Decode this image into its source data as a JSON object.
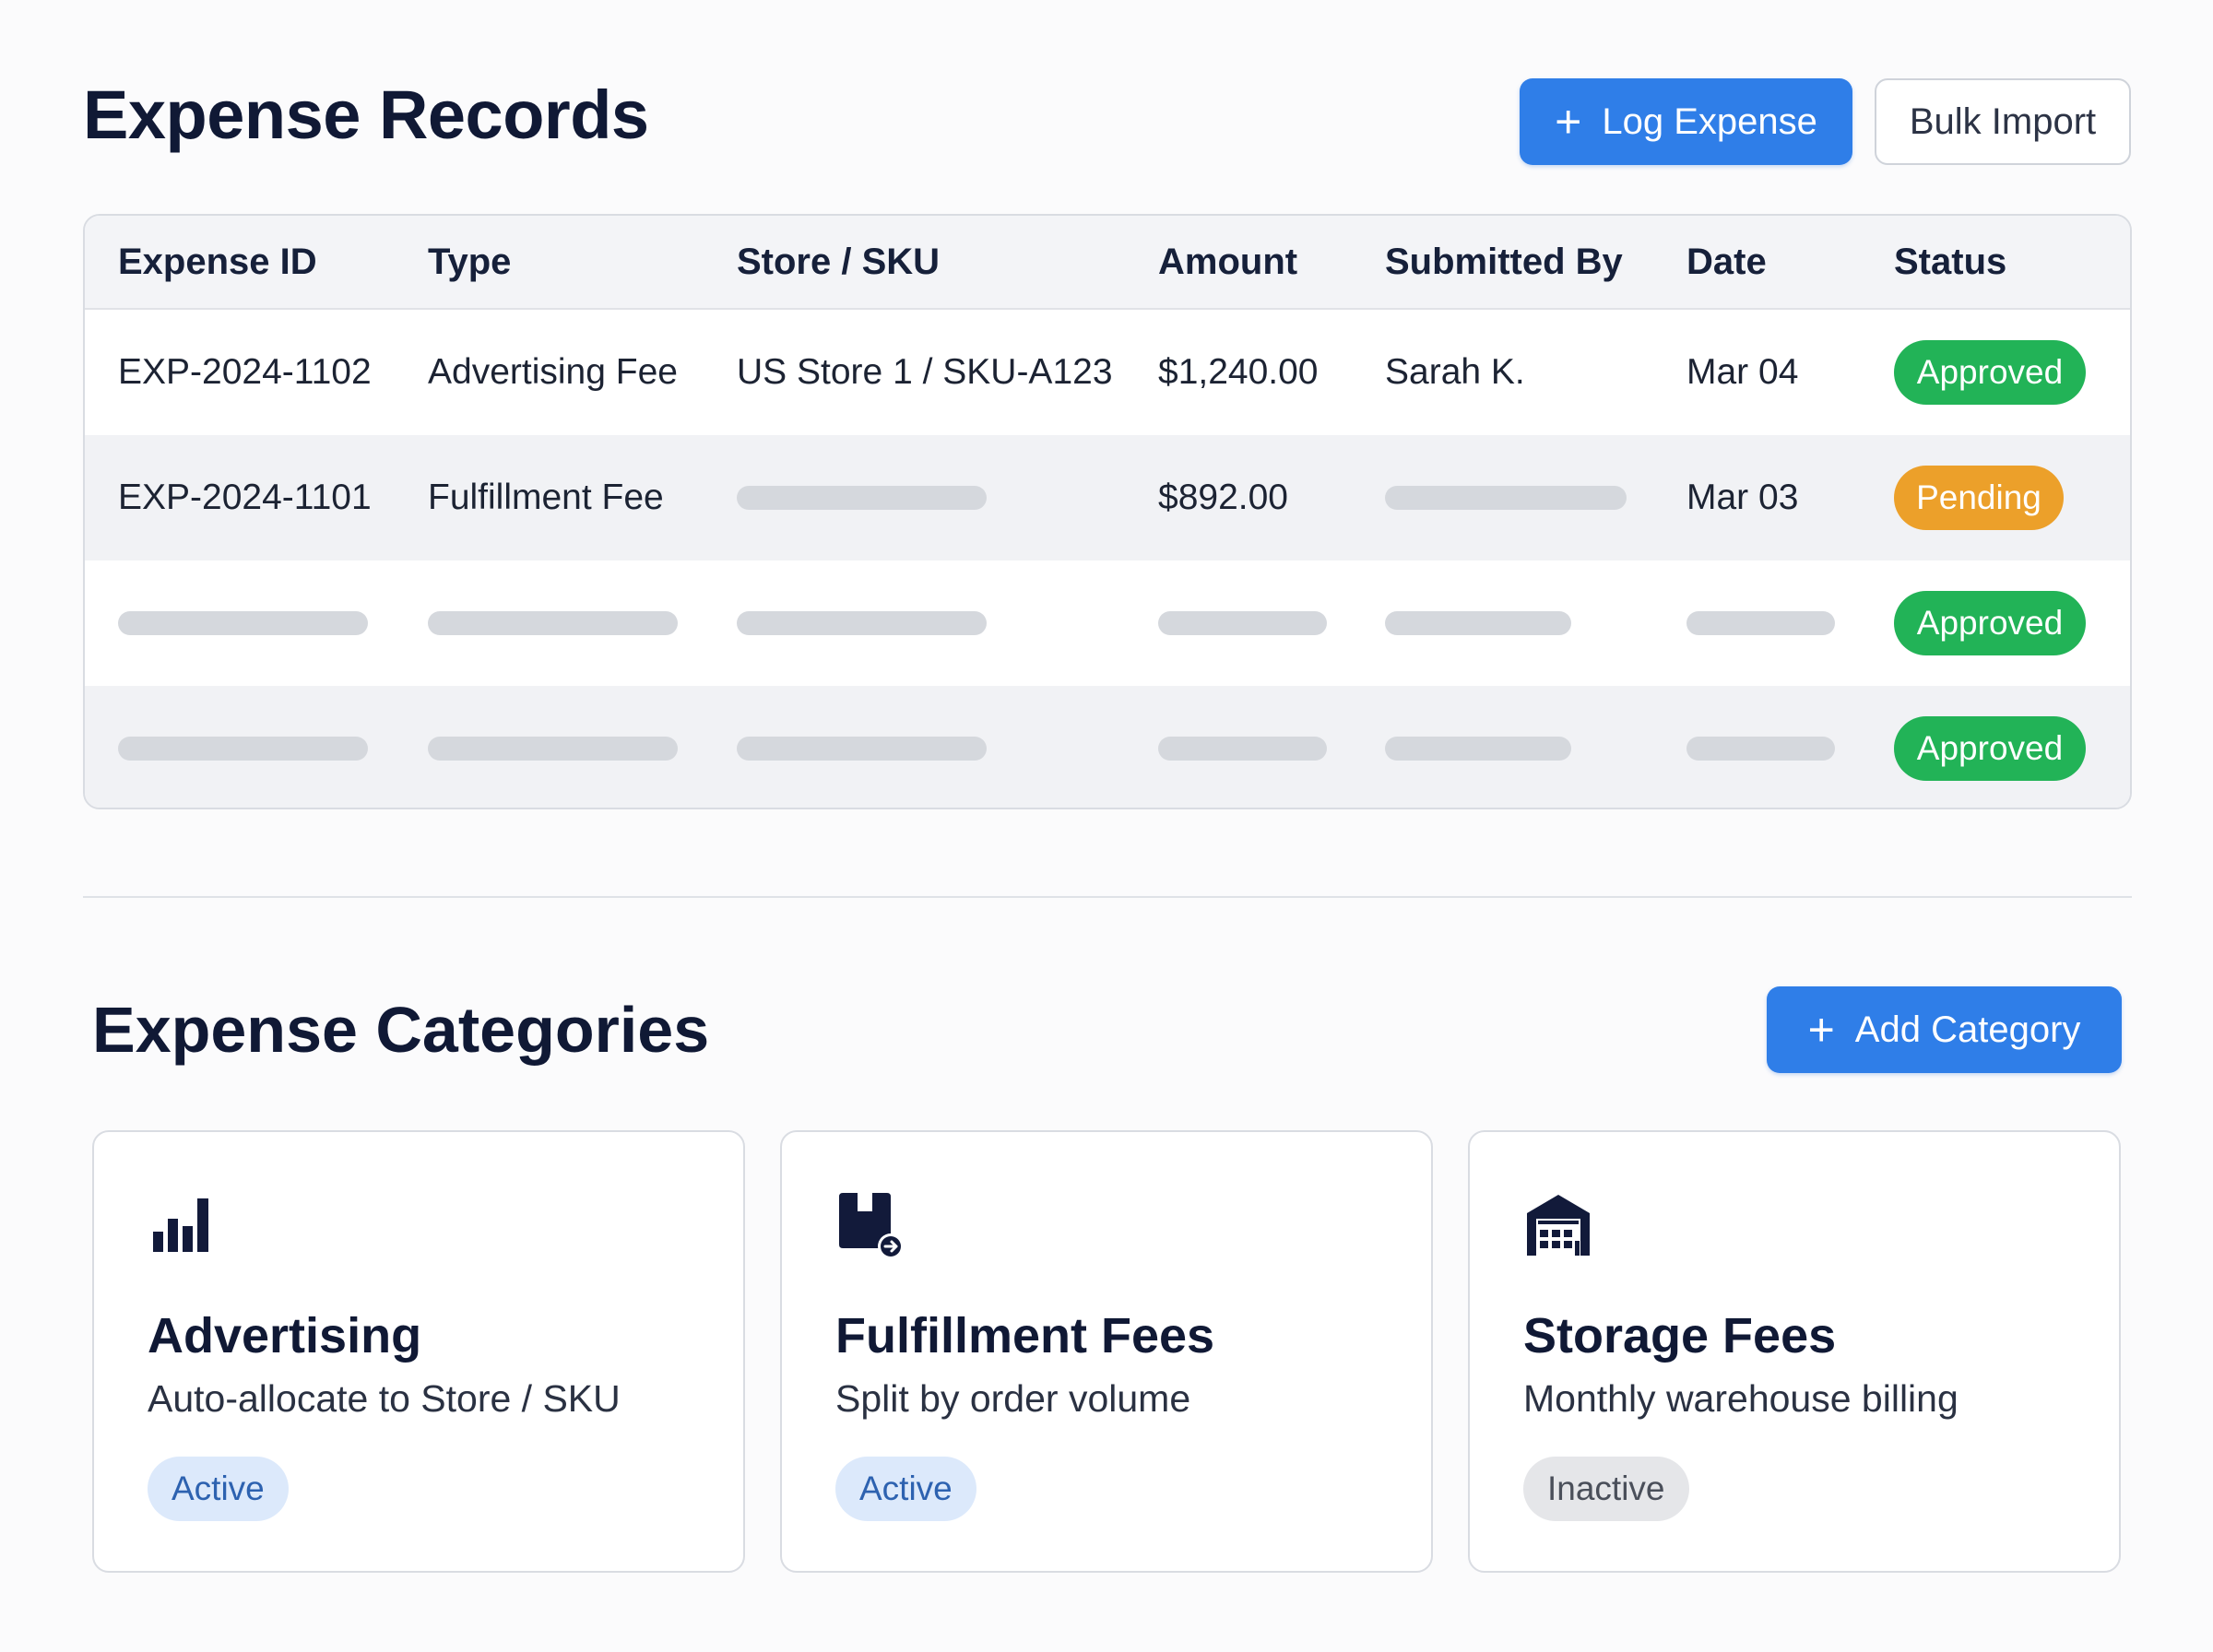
{
  "records": {
    "title": "Expense Records",
    "log_expense_label": "Log Expense",
    "bulk_import_label": "Bulk Import",
    "columns": [
      "Expense ID",
      "Type",
      "Store / SKU",
      "Amount",
      "Submitted By",
      "Date",
      "Status"
    ],
    "rows": [
      {
        "id": "EXP-2024-1102",
        "type": "Advertising Fee",
        "store_sku": "US Store 1 / SKU-A123",
        "amount": "$1,240.00",
        "submitted_by": "Sarah K.",
        "date": "Mar 04",
        "status": "Approved"
      },
      {
        "id": "EXP-2024-1101",
        "type": "Fulfillment Fee",
        "store_sku": null,
        "amount": "$892.00",
        "submitted_by": null,
        "date": "Mar 03",
        "status": "Pending"
      },
      {
        "id": null,
        "type": null,
        "store_sku": null,
        "amount": null,
        "submitted_by": null,
        "date": null,
        "status": "Approved"
      },
      {
        "id": null,
        "type": null,
        "store_sku": null,
        "amount": null,
        "submitted_by": null,
        "date": null,
        "status": "Approved"
      }
    ],
    "status_colors": {
      "Approved": "#22b357",
      "Pending": "#eca02a"
    }
  },
  "categories": {
    "title": "Expense Categories",
    "add_label": "Add Category",
    "items": [
      {
        "name": "Advertising",
        "description": "Auto-allocate to Store / SKU",
        "status": "Active",
        "icon": "bar-chart-icon"
      },
      {
        "name": "Fulfillment Fees",
        "description": "Split by order volume",
        "status": "Active",
        "icon": "package-arrow-icon"
      },
      {
        "name": "Storage Fees",
        "description": "Monthly warehouse billing",
        "status": "Inactive",
        "icon": "warehouse-icon"
      }
    ]
  },
  "colors": {
    "accent": "#2f7ee8",
    "heading": "#101935"
  }
}
